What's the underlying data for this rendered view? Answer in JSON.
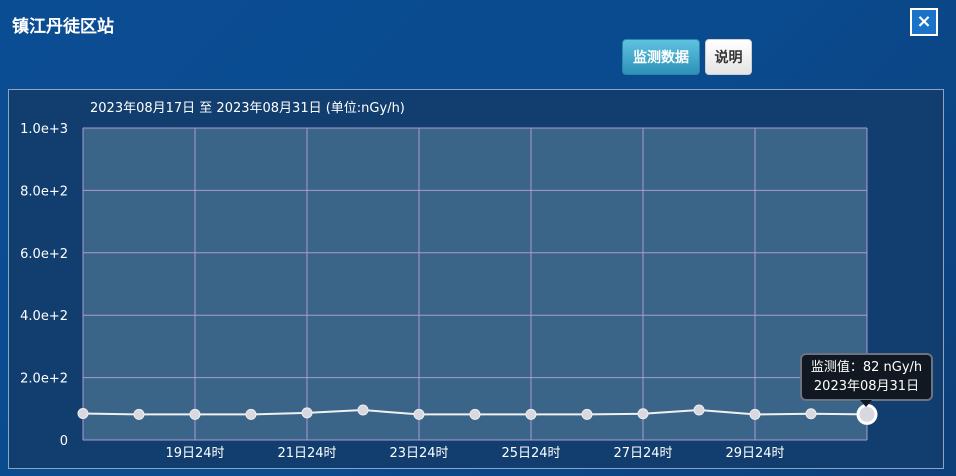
{
  "window": {
    "title": "镇江丹徒区站",
    "close_label": "×"
  },
  "toolbar": {
    "data_button": "监测数据",
    "desc_button": "说明"
  },
  "range_label": "2023年08月17日 至 2023年08月31日 (单位:nGy/h)",
  "tooltip": {
    "value_line": "监测值：82 nGy/h",
    "date_line": "2023年08月31日"
  },
  "colors": {
    "plot_bg": "#3a6589",
    "grid": "#a99ad4",
    "line": "#f0f0f0",
    "point_fill": "#d8d8e0",
    "axis_text": "#ffffff"
  },
  "chart_data": {
    "type": "line",
    "x": [
      "08月17日",
      "08月18日",
      "08月19日",
      "08月20日",
      "08月21日",
      "08月22日",
      "08月23日",
      "08月24日",
      "08月25日",
      "08月26日",
      "08月27日",
      "08月28日",
      "08月29日",
      "08月30日",
      "08月31日"
    ],
    "series": [
      {
        "values": [
          85,
          82,
          82,
          82,
          87,
          96,
          82,
          82,
          82,
          82,
          84,
          96,
          82,
          84,
          82
        ]
      }
    ],
    "y_tick_labels": [
      "0",
      "2.0e+2",
      "4.0e+2",
      "6.0e+2",
      "8.0e+2",
      "1.0e+3"
    ],
    "x_tick_labels": [
      "19日24时",
      "21日24时",
      "23日24时",
      "25日24时",
      "27日24时",
      "29日24时"
    ],
    "ylim": [
      0,
      1000
    ],
    "grid": true,
    "highlighted_index": 14
  }
}
